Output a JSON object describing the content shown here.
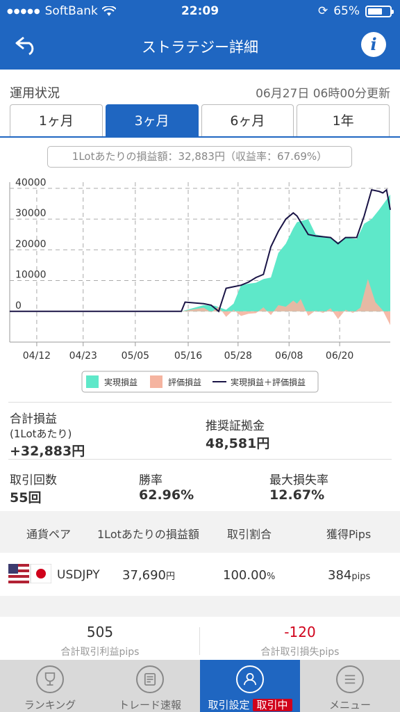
{
  "status_bar": {
    "carrier": "SoftBank",
    "time": "22:09",
    "battery": "65%",
    "battery_level": 0.65
  },
  "header": {
    "title": "ストラテジー詳細",
    "back_icon": "back-arrow-icon",
    "info_icon": "info-icon"
  },
  "section": {
    "label": "運用状況",
    "updated": "06月27日 06時00分更新"
  },
  "tabs": [
    {
      "label": "1ヶ月",
      "active": false
    },
    {
      "label": "3ヶ月",
      "active": true
    },
    {
      "label": "6ヶ月",
      "active": false
    },
    {
      "label": "1年",
      "active": false
    }
  ],
  "summary": "1Lotあたりの損益額：32,883円（収益率：67.69%）",
  "chart_data": {
    "type": "area",
    "y_ticks": [
      "40000",
      "30000",
      "20000",
      "10000",
      "0"
    ],
    "ylim": [
      -10000,
      42000
    ],
    "x_ticks": [
      "04/12",
      "04/23",
      "05/05",
      "05/16",
      "05/28",
      "06/08",
      "06/20"
    ],
    "legend": [
      "実現損益",
      "評価損益",
      "実現損益＋評価損益"
    ],
    "colors": {
      "realized": "#5ee8c9",
      "unrealized": "#f5b4a0",
      "total": "#1a1446"
    },
    "series": [
      {
        "name": "実現損益",
        "points": [
          [
            0,
            0
          ],
          [
            0.46,
            0
          ],
          [
            0.52,
            2000
          ],
          [
            0.55,
            1800
          ],
          [
            0.58,
            500
          ],
          [
            0.6,
            2500
          ],
          [
            0.62,
            8500
          ],
          [
            0.64,
            9000
          ],
          [
            0.66,
            9300
          ],
          [
            0.68,
            10500
          ],
          [
            0.7,
            11000
          ],
          [
            0.72,
            19000
          ],
          [
            0.74,
            22000
          ],
          [
            0.76,
            27000
          ],
          [
            0.77,
            29000
          ],
          [
            0.8,
            30000
          ],
          [
            0.82,
            25000
          ],
          [
            0.86,
            24000
          ],
          [
            0.88,
            22500
          ],
          [
            0.9,
            24000
          ],
          [
            0.93,
            23500
          ],
          [
            0.95,
            28500
          ],
          [
            0.97,
            30000
          ],
          [
            0.99,
            33000
          ],
          [
            1.02,
            38000
          ]
        ]
      },
      {
        "name": "評価損益",
        "points": [
          [
            0,
            0
          ],
          [
            0.46,
            0
          ],
          [
            0.52,
            1200
          ],
          [
            0.54,
            -300
          ],
          [
            0.56,
            1500
          ],
          [
            0.58,
            -1800
          ],
          [
            0.6,
            500
          ],
          [
            0.62,
            -1500
          ],
          [
            0.64,
            -800
          ],
          [
            0.66,
            -600
          ],
          [
            0.68,
            1300
          ],
          [
            0.7,
            -1200
          ],
          [
            0.72,
            2000
          ],
          [
            0.74,
            1500
          ],
          [
            0.76,
            3500
          ],
          [
            0.77,
            2500
          ],
          [
            0.78,
            4000
          ],
          [
            0.8,
            -1500
          ],
          [
            0.82,
            300
          ],
          [
            0.84,
            -500
          ],
          [
            0.86,
            1000
          ],
          [
            0.88,
            -2500
          ],
          [
            0.9,
            500
          ],
          [
            0.92,
            -500
          ],
          [
            0.94,
            1200
          ],
          [
            0.96,
            10500
          ],
          [
            0.98,
            3000
          ],
          [
            1.0,
            300
          ],
          [
            1.02,
            -4500
          ]
        ]
      },
      {
        "name": "実現損益＋評価損益",
        "points": [
          [
            0,
            0
          ],
          [
            0.46,
            0
          ],
          [
            0.47,
            3000
          ],
          [
            0.52,
            2500
          ],
          [
            0.54,
            2000
          ],
          [
            0.56,
            0
          ],
          [
            0.58,
            7500
          ],
          [
            0.6,
            8000
          ],
          [
            0.62,
            8500
          ],
          [
            0.64,
            9500
          ],
          [
            0.66,
            11000
          ],
          [
            0.68,
            12000
          ],
          [
            0.7,
            21000
          ],
          [
            0.72,
            26000
          ],
          [
            0.74,
            30000
          ],
          [
            0.76,
            32000
          ],
          [
            0.77,
            31000
          ],
          [
            0.8,
            25000
          ],
          [
            0.82,
            24500
          ],
          [
            0.86,
            24000
          ],
          [
            0.88,
            22000
          ],
          [
            0.9,
            24000
          ],
          [
            0.93,
            24000
          ],
          [
            0.95,
            31000
          ],
          [
            0.97,
            39500
          ],
          [
            0.99,
            39000
          ],
          [
            1.0,
            38500
          ],
          [
            1.01,
            39500
          ],
          [
            1.02,
            33000
          ]
        ]
      }
    ]
  },
  "metrics": {
    "total_pl_label": "合計損益",
    "total_pl_sub": "(1Lotあたり)",
    "total_pl_value": "+32,883円",
    "margin_label": "推奨証拠金",
    "margin_value": "48,581円",
    "trades_label": "取引回数",
    "trades_value": "55回",
    "winrate_label": "勝率",
    "winrate_value": "62.96%",
    "drawdown_label": "最大損失率",
    "drawdown_value": "12.67%"
  },
  "table": {
    "headers": [
      "通貨ペア",
      "1Lotあたりの損益額",
      "取引割合",
      "獲得Pips"
    ],
    "rows": [
      {
        "pair": "USDJPY",
        "pl": "37,690",
        "pl_unit": "円",
        "ratio": "100.00",
        "ratio_unit": "%",
        "pips": "384",
        "pips_unit": "pips"
      }
    ]
  },
  "pips_summary": {
    "profit_value": "505",
    "profit_label": "合計取引利益pips",
    "loss_value": "-120",
    "loss_label": "合計取引損失pips"
  },
  "tabbar": [
    {
      "label": "ランキング",
      "icon": "trophy-icon",
      "active": false
    },
    {
      "label": "トレード速報",
      "icon": "news-icon",
      "active": false
    },
    {
      "label": "取引設定",
      "badge": "取引中",
      "icon": "user-icon",
      "active": true
    },
    {
      "label": "メニュー",
      "icon": "menu-icon",
      "active": false
    }
  ]
}
